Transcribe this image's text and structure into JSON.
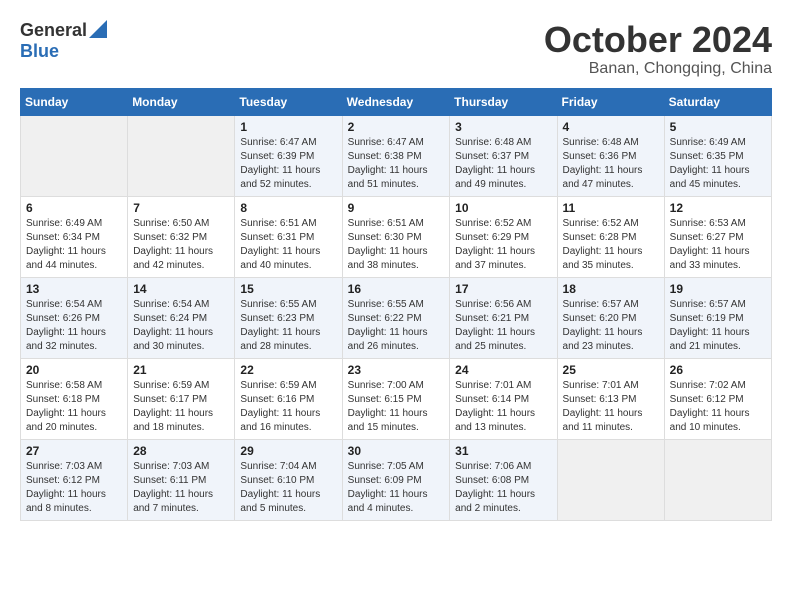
{
  "header": {
    "logo_general": "General",
    "logo_blue": "Blue",
    "month_title": "October 2024",
    "location": "Banan, Chongqing, China"
  },
  "days_of_week": [
    "Sunday",
    "Monday",
    "Tuesday",
    "Wednesday",
    "Thursday",
    "Friday",
    "Saturday"
  ],
  "weeks": [
    [
      {
        "day": "",
        "info": ""
      },
      {
        "day": "",
        "info": ""
      },
      {
        "day": "1",
        "info": "Sunrise: 6:47 AM\nSunset: 6:39 PM\nDaylight: 11 hours and 52 minutes."
      },
      {
        "day": "2",
        "info": "Sunrise: 6:47 AM\nSunset: 6:38 PM\nDaylight: 11 hours and 51 minutes."
      },
      {
        "day": "3",
        "info": "Sunrise: 6:48 AM\nSunset: 6:37 PM\nDaylight: 11 hours and 49 minutes."
      },
      {
        "day": "4",
        "info": "Sunrise: 6:48 AM\nSunset: 6:36 PM\nDaylight: 11 hours and 47 minutes."
      },
      {
        "day": "5",
        "info": "Sunrise: 6:49 AM\nSunset: 6:35 PM\nDaylight: 11 hours and 45 minutes."
      }
    ],
    [
      {
        "day": "6",
        "info": "Sunrise: 6:49 AM\nSunset: 6:34 PM\nDaylight: 11 hours and 44 minutes."
      },
      {
        "day": "7",
        "info": "Sunrise: 6:50 AM\nSunset: 6:32 PM\nDaylight: 11 hours and 42 minutes."
      },
      {
        "day": "8",
        "info": "Sunrise: 6:51 AM\nSunset: 6:31 PM\nDaylight: 11 hours and 40 minutes."
      },
      {
        "day": "9",
        "info": "Sunrise: 6:51 AM\nSunset: 6:30 PM\nDaylight: 11 hours and 38 minutes."
      },
      {
        "day": "10",
        "info": "Sunrise: 6:52 AM\nSunset: 6:29 PM\nDaylight: 11 hours and 37 minutes."
      },
      {
        "day": "11",
        "info": "Sunrise: 6:52 AM\nSunset: 6:28 PM\nDaylight: 11 hours and 35 minutes."
      },
      {
        "day": "12",
        "info": "Sunrise: 6:53 AM\nSunset: 6:27 PM\nDaylight: 11 hours and 33 minutes."
      }
    ],
    [
      {
        "day": "13",
        "info": "Sunrise: 6:54 AM\nSunset: 6:26 PM\nDaylight: 11 hours and 32 minutes."
      },
      {
        "day": "14",
        "info": "Sunrise: 6:54 AM\nSunset: 6:24 PM\nDaylight: 11 hours and 30 minutes."
      },
      {
        "day": "15",
        "info": "Sunrise: 6:55 AM\nSunset: 6:23 PM\nDaylight: 11 hours and 28 minutes."
      },
      {
        "day": "16",
        "info": "Sunrise: 6:55 AM\nSunset: 6:22 PM\nDaylight: 11 hours and 26 minutes."
      },
      {
        "day": "17",
        "info": "Sunrise: 6:56 AM\nSunset: 6:21 PM\nDaylight: 11 hours and 25 minutes."
      },
      {
        "day": "18",
        "info": "Sunrise: 6:57 AM\nSunset: 6:20 PM\nDaylight: 11 hours and 23 minutes."
      },
      {
        "day": "19",
        "info": "Sunrise: 6:57 AM\nSunset: 6:19 PM\nDaylight: 11 hours and 21 minutes."
      }
    ],
    [
      {
        "day": "20",
        "info": "Sunrise: 6:58 AM\nSunset: 6:18 PM\nDaylight: 11 hours and 20 minutes."
      },
      {
        "day": "21",
        "info": "Sunrise: 6:59 AM\nSunset: 6:17 PM\nDaylight: 11 hours and 18 minutes."
      },
      {
        "day": "22",
        "info": "Sunrise: 6:59 AM\nSunset: 6:16 PM\nDaylight: 11 hours and 16 minutes."
      },
      {
        "day": "23",
        "info": "Sunrise: 7:00 AM\nSunset: 6:15 PM\nDaylight: 11 hours and 15 minutes."
      },
      {
        "day": "24",
        "info": "Sunrise: 7:01 AM\nSunset: 6:14 PM\nDaylight: 11 hours and 13 minutes."
      },
      {
        "day": "25",
        "info": "Sunrise: 7:01 AM\nSunset: 6:13 PM\nDaylight: 11 hours and 11 minutes."
      },
      {
        "day": "26",
        "info": "Sunrise: 7:02 AM\nSunset: 6:12 PM\nDaylight: 11 hours and 10 minutes."
      }
    ],
    [
      {
        "day": "27",
        "info": "Sunrise: 7:03 AM\nSunset: 6:12 PM\nDaylight: 11 hours and 8 minutes."
      },
      {
        "day": "28",
        "info": "Sunrise: 7:03 AM\nSunset: 6:11 PM\nDaylight: 11 hours and 7 minutes."
      },
      {
        "day": "29",
        "info": "Sunrise: 7:04 AM\nSunset: 6:10 PM\nDaylight: 11 hours and 5 minutes."
      },
      {
        "day": "30",
        "info": "Sunrise: 7:05 AM\nSunset: 6:09 PM\nDaylight: 11 hours and 4 minutes."
      },
      {
        "day": "31",
        "info": "Sunrise: 7:06 AM\nSunset: 6:08 PM\nDaylight: 11 hours and 2 minutes."
      },
      {
        "day": "",
        "info": ""
      },
      {
        "day": "",
        "info": ""
      }
    ]
  ]
}
